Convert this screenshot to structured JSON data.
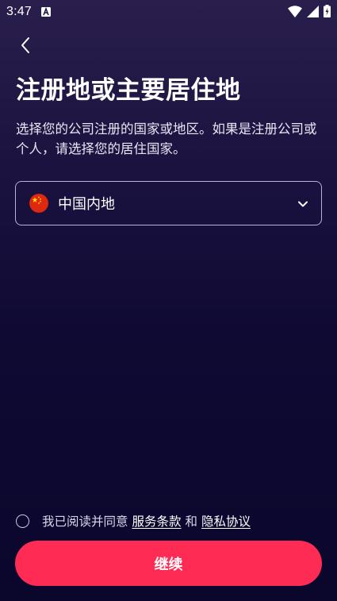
{
  "status_bar": {
    "time": "3:47",
    "icons": [
      "app-notification-icon",
      "wifi-icon",
      "cell-signal-icon",
      "battery-charging-icon"
    ]
  },
  "nav": {
    "back_icon": "chevron-left-icon"
  },
  "title": "注册地或主要居住地",
  "description": "选择您的公司注册的国家或地区。如果是注册公司或个人，请选择您的居住国家。",
  "country_select": {
    "flag_icon": "china-flag-icon",
    "value": "中国内地",
    "dropdown_icon": "chevron-down-icon"
  },
  "agreement": {
    "prefix": "我已阅读并同意",
    "terms_link": "服务条款",
    "connector": "和",
    "privacy_link": "隐私协议",
    "checked": false
  },
  "continue_label": "继续",
  "colors": {
    "accent": "#fe2c55",
    "background_top": "#2a1f4c",
    "background_bottom": "#0a062c",
    "border": "#b6b2d8"
  }
}
